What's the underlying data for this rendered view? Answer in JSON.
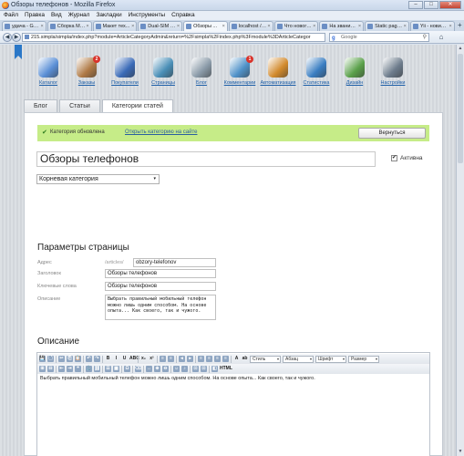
{
  "window": {
    "title": "Обзоры телефонов - Mozilla Firefox",
    "minimize": "–",
    "maximize": "□",
    "close": "✕"
  },
  "menu": [
    "Файл",
    "Правка",
    "Вид",
    "Журнал",
    "Закладки",
    "Инструменты",
    "Справка"
  ],
  "tabs": [
    {
      "label": "удача - Go..."
    },
    {
      "label": "Сборка Ма..."
    },
    {
      "label": "Макет тех..."
    },
    {
      "label": "Dual-SIM во..."
    },
    {
      "label": "Обзоры ..."
    },
    {
      "label": "localhost / ..."
    },
    {
      "label": "Что нового ..."
    },
    {
      "label": "На званиe ..."
    },
    {
      "label": "Static pages..."
    },
    {
      "label": "Yii - новичк..."
    }
  ],
  "active_tab_index": 4,
  "new_tab_label": "+",
  "nav": {
    "back": "◀",
    "forward": "▶",
    "url": "215.simpla/simpla/index.php?module=ArticleCategoryAdmin&return=%2Fsimpla%2Findex.php%3Fmodule%3DArticleCategor",
    "search_placeholder": "Google",
    "search_engine_glyph": "g",
    "search_glyph": "⚲",
    "home_glyph": "⌂"
  },
  "scrollbar": {
    "up": "▲",
    "down": "▼"
  },
  "admin_icons": [
    {
      "label": "Каталог",
      "icon": "catalog-icon",
      "color": "#5a8fd6"
    },
    {
      "label": "Заказы",
      "icon": "orders-icon",
      "color": "#b07a45",
      "badge": "2"
    },
    {
      "label": "Покупатели",
      "icon": "buyers-icon",
      "color": "#3b6bb8"
    },
    {
      "label": "Страницы",
      "icon": "pages-icon",
      "color": "#4a8fb7"
    },
    {
      "label": "Блог",
      "icon": "blog-icon",
      "color": "#8a9aa8"
    },
    {
      "label": "Комментарии",
      "icon": "comments-icon",
      "color": "#4f92c9",
      "badge": "1"
    },
    {
      "label": "Автоматизация",
      "icon": "automation-icon",
      "color": "#d28a2c"
    },
    {
      "label": "Статистика",
      "icon": "statistics-icon",
      "color": "#3a7ec2"
    },
    {
      "label": "Дизайн",
      "icon": "design-icon",
      "color": "#5aa04a"
    },
    {
      "label": "Настройки",
      "icon": "settings-icon",
      "color": "#6d7c8c"
    }
  ],
  "page_tabs": [
    {
      "label": "Блог",
      "active": false
    },
    {
      "label": "Статьи",
      "active": false
    },
    {
      "label": "Категории статей",
      "active": true
    }
  ],
  "notice": {
    "text": "Категория обновлена",
    "link": "Открыть категорию на сайте",
    "back_button": "Вернуться",
    "check_glyph": "✔"
  },
  "category": {
    "name": "Обзоры телефонов",
    "active_label": "Активна",
    "active_checked": true,
    "check_glyph": "✔",
    "parent": "Корневая категория",
    "dropdown_glyph": "▾"
  },
  "params": {
    "heading": "Параметры страницы",
    "address_label": "Адрес",
    "address_prefix": "/articles/",
    "address_value": "obzory-telefonov",
    "title_label": "Заголовок",
    "title_value": "Обзоры телефонов",
    "keywords_label": "Ключевые слова",
    "keywords_value": "Обзоры телефонов",
    "description_label": "Описание",
    "description_value": "Выбрать правильный мобильный телефон можно лишь одним способом. На основе опыта... Как своего, так и чужого."
  },
  "description_section": {
    "heading": "Описание",
    "content": "Выбрать правильный мобильный телефон можно лишь одним способом. На основе опыта... Как своего, так и чужого.",
    "style_select": "Стиль",
    "paragraph_select": "Абзац",
    "font_select": "Шрифт",
    "size_select": "Размер",
    "html_label": "HTML"
  },
  "toolbar_row1": [
    "💾",
    "🗋",
    "",
    "✂",
    "⎘",
    "📋",
    "",
    "↶",
    "↷",
    "",
    "B",
    "I",
    "U",
    "ABC",
    "",
    "x₂",
    "x²",
    "",
    "≡",
    "≡",
    "",
    "⫷",
    "⫸",
    "",
    "≡",
    "≡",
    "≡",
    "≡",
    "",
    "A",
    "ab"
  ],
  "toolbar_row2": [
    "⊞",
    "⊟",
    "",
    "⇤",
    "⇥",
    "❝",
    "",
    "⚓",
    "⛓",
    "",
    "☰",
    "▦",
    "",
    "Ω",
    "",
    "⌫",
    "",
    "↔",
    "⊕",
    "⊖",
    "",
    "☺",
    "♪",
    "",
    "⊡",
    "⊡",
    "",
    "◧"
  ]
}
